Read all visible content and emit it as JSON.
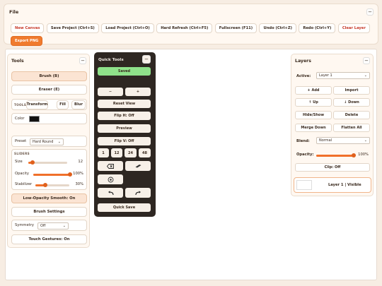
{
  "file": {
    "title": "File",
    "collapse": "−",
    "buttons": [
      {
        "label": "New Canvas",
        "style": "red"
      },
      {
        "label": "Save Project (Ctrl+S)"
      },
      {
        "label": "Load Project (Ctrl+O)"
      },
      {
        "label": "Hard Refresh (Ctrl+F5)"
      },
      {
        "label": "Fullscreen (F11)"
      },
      {
        "label": "Undo (Ctrl+Z)"
      },
      {
        "label": "Redo (Ctrl+Y)"
      },
      {
        "label": "Clear Layer",
        "style": "red"
      }
    ],
    "export_label": "Export PNG"
  },
  "tools": {
    "title": "Tools",
    "collapse": "−",
    "brush": "Brush (B)",
    "eraser": "Eraser (E)",
    "tools_label": "TOOLS",
    "transform": "Transform",
    "fill": "Fill",
    "blur": "Blur",
    "color_label": "Color",
    "color_value": "#111111",
    "preset_label": "Preset",
    "preset_value": "Hard Round",
    "sliders_label": "SLIDERS",
    "size_label": "Size",
    "size_value": "12",
    "size_fraction": 0.1,
    "opacity_label": "Opacity",
    "opacity_value": "100%",
    "opacity_fraction": 1.0,
    "stabilizer_label": "Stabilizer",
    "stabilizer_value": "30%",
    "stabilizer_fraction": 0.3,
    "smooth": "Low-Opacity Smooth: On",
    "brush_settings": "Brush Settings",
    "symmetry_label": "Symmetry",
    "symmetry_value": "Off",
    "touch": "Touch Gestures: On"
  },
  "quick": {
    "title": "Quick Tools",
    "collapse": "−",
    "saved": "Saved",
    "minus": "−",
    "plus": "+",
    "reset_view": "Reset View",
    "flip_h": "Flip H: Off",
    "preview": "Preview",
    "flip_v": "Flip V: Off",
    "sizes": [
      "1",
      "12",
      "24",
      "48"
    ],
    "quick_save": "Quick Save"
  },
  "layers": {
    "title": "Layers",
    "collapse": "−",
    "active_label": "Active:",
    "active_value": "Layer 1",
    "add": "+ Add",
    "import": "Import",
    "up": "↑ Up",
    "down": "↓ Down",
    "hide_show": "Hide/Show",
    "delete": "Delete",
    "merge_down": "Merge Down",
    "flatten": "Flatten All",
    "blend_label": "Blend:",
    "blend_value": "Normal",
    "opacity_label": "Opacity:",
    "opacity_value": "100%",
    "opacity_fraction": 1.0,
    "clip": "Clip: Off",
    "layer_item": "Layer 1 | Visible"
  },
  "colors": {
    "accent": "#f07b2e",
    "saved_green": "#8fe28a",
    "dark_panel": "#2e2722"
  }
}
